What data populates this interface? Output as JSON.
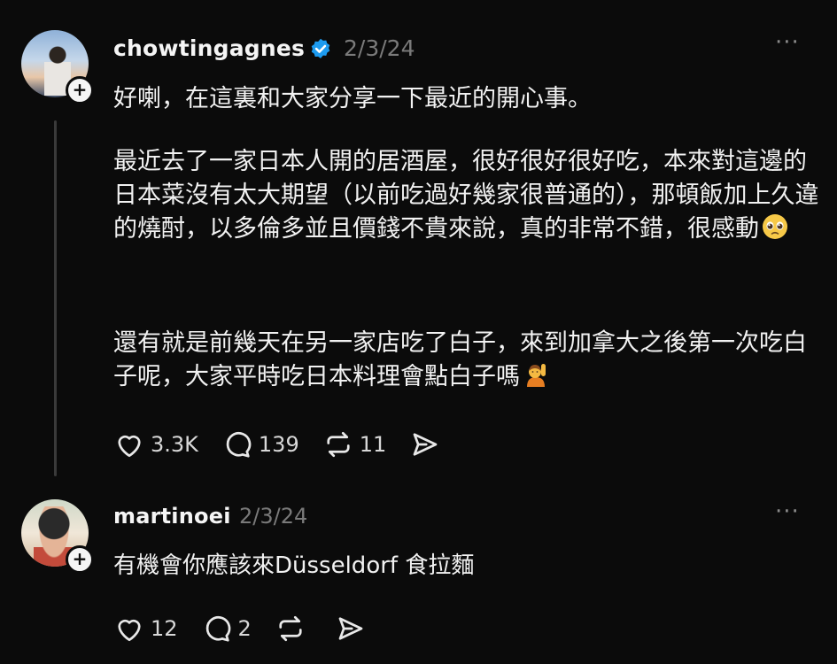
{
  "post": {
    "username": "chowtingagnes",
    "timestamp": "2/3/24",
    "more": "···",
    "paragraphs": [
      "好喇，在這裏和大家分享一下最近的開心事。",
      "最近去了一家日本人開的居酒屋，很好很好很好吃，本來對這邊的日本菜沒有太大期望（以前吃過好幾家很普通的），那頓飯加上久違的燒酎，以多倫多並且價錢不貴來說，真的非常不錯，很感動",
      "還有就是前幾天在另一家店吃了白子，來到加拿大之後第一次吃白子呢，大家平時吃日本料理會點白子嗎"
    ],
    "likes": "3.3K",
    "comments": "139",
    "reposts": "11"
  },
  "reply": {
    "username": "martinoei",
    "timestamp": "2/3/24",
    "more": "···",
    "text": "有機會你應該來Düsseldorf 食拉麵",
    "likes": "12",
    "comments": "2",
    "reposts": ""
  },
  "icons": [
    "verified-badge-icon",
    "heart-icon",
    "comment-icon",
    "repost-icon",
    "share-icon",
    "pleading-face-emoji",
    "raising-hand-emoji"
  ],
  "colors": {
    "background": "#0b0b0b",
    "verified": "#1d9bf0",
    "muted": "#7a7a7a"
  }
}
